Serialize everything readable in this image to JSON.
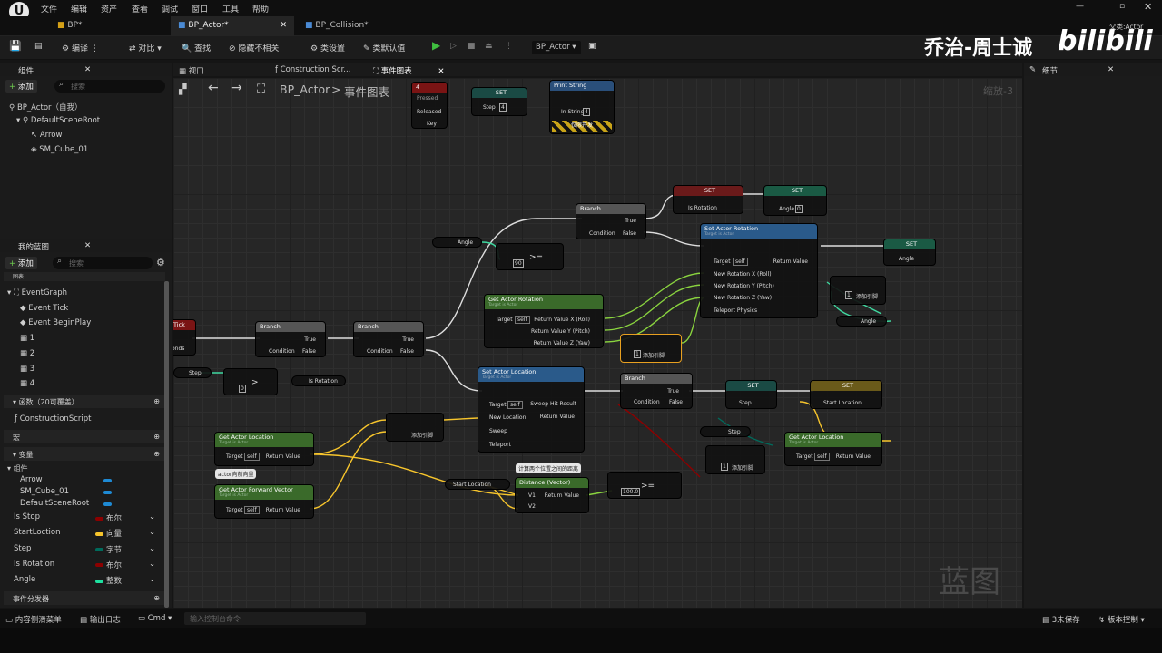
{
  "menu": [
    "文件",
    "编辑",
    "资产",
    "查看",
    "调试",
    "窗口",
    "工具",
    "帮助"
  ],
  "tabs": [
    "BP*",
    "BP_Actor*",
    "BP_Collision*"
  ],
  "toolbar": {
    "compile": "编译",
    "diff": "对比",
    "find": "查找",
    "hide": "隐藏不相关",
    "class_settings": "类设置",
    "class_defaults": "类默认值",
    "debug_object": "BP_Actor"
  },
  "watermark": {
    "author": "乔治-周士诚",
    "logo": "bilibili",
    "sub": "父类:Actor"
  },
  "components": {
    "title": "组件",
    "add": "添加",
    "search_placeholder": "搜索",
    "items": [
      "BP_Actor（自我）",
      "DefaultSceneRoot",
      "Arrow",
      "SM_Cube_01"
    ]
  },
  "mybp": {
    "title": "我的蓝图",
    "add": "添加",
    "search_placeholder": "搜索",
    "graphs_header": "图表",
    "eventgraph": "EventGraph",
    "events": [
      "Event Tick",
      "Event BeginPlay",
      "1",
      "2",
      "3",
      "4"
    ],
    "functions_header": "函数（20可覆盖）",
    "construction": "ConstructionScript",
    "macros_header": "宏",
    "vars_header": "变量",
    "comp_header": "组件",
    "comp_vars": [
      "Arrow",
      "SM_Cube_01",
      "DefaultSceneRoot"
    ],
    "vars": [
      {
        "name": "Is Stop",
        "type": "布尔",
        "color": "#8c0000"
      },
      {
        "name": "StartLoction",
        "type": "向量",
        "color": "#f7c52c"
      },
      {
        "name": "Step",
        "type": "字节",
        "color": "#006b5c"
      },
      {
        "name": "Is Rotation",
        "type": "布尔",
        "color": "#8c0000"
      },
      {
        "name": "Angle",
        "type": "整数",
        "color": "#1ee0a0"
      }
    ],
    "dispatchers": "事件分发器"
  },
  "graph": {
    "tabs": [
      "视口",
      "Construction Scr...",
      "事件图表"
    ],
    "breadcrumb_root": "BP_Actor",
    "breadcrumb_sep": ">",
    "breadcrumb_current": "事件图表",
    "zoom": "缩放-3",
    "watermark": "蓝图"
  },
  "details": {
    "title": "细节"
  },
  "nodes": {
    "branch": "Branch",
    "true": "True",
    "false": "False",
    "condition": "Condition",
    "set": "SET",
    "is_rotation": "Is Rotation",
    "angle": "Angle",
    "step": "Step",
    "set_rot": "Set Actor Rotation",
    "target_is_actor": "Target is Actor",
    "target": "Target",
    "self": "self",
    "ret": "Return Value",
    "new_rot_x": "New Rotation X (Roll)",
    "new_rot_y": "New Rotation Y (Pitch)",
    "new_rot_z": "New Rotation Z (Yaw)",
    "teleport_physics": "Teleport Physics",
    "get_rot": "Get Actor Rotation",
    "ret_x": "Return Value X (Roll)",
    "ret_y": "Return Value Y (Pitch)",
    "ret_z": "Return Value Z (Yaw)",
    "set_loc": "Set Actor Location",
    "new_loc": "New Location",
    "sweep": "Sweep",
    "teleport": "Teleport",
    "sweep_hit": "Sweep Hit Result",
    "get_loc": "Get Actor Location",
    "get_fwd": "Get Actor Forward Vector",
    "distance": "Distance (Vector)",
    "dist_comment": "计算两个位置之间的距离",
    "fwd_comment": "actor向前向量",
    "start_loc": "Start Location",
    "add_pin": "添加引脚",
    "v1": "V1",
    "v2": "V2",
    "print": "Print String",
    "in_string": "In String",
    "dev_only": "仅限开发",
    "pressed": "Pressed",
    "released": "Released",
    "key": "Key",
    "tick": "Tick",
    "seconds": "onds",
    "val90": "90",
    "val0": "0",
    "val4": "4",
    "val1": "1",
    "val100": "100.0",
    "ge": ">=",
    "gt": ">"
  },
  "status": {
    "drawer": "内容侧滑菜单",
    "log": "输出日志",
    "cmd": "Cmd",
    "cmd_placeholder": "输入控制台命令",
    "unsaved": "3未保存",
    "source_control": "版本控制"
  }
}
